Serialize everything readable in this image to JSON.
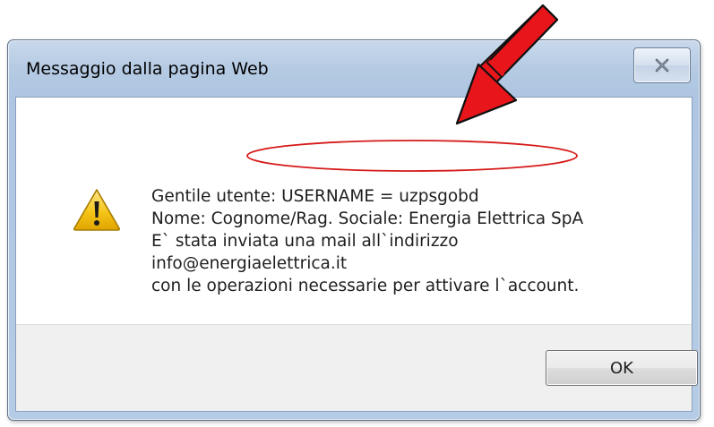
{
  "dialog": {
    "title": "Messaggio dalla pagina Web",
    "close_icon": "close-x-icon",
    "warning_icon": "warning-triangle-icon",
    "message_lines": [
      "Gentile utente: USERNAME = uzpsgobd",
      "Nome:  Cognome/Rag. Sociale: Energia Elettrica SpA",
      "E` stata inviata una mail all`indirizzo",
      "info@energiaelettrica.it",
      "con le operazioni necessarie per attivare l`account."
    ],
    "ok_label": "OK"
  },
  "annotations": {
    "arrow_color": "#e8161b",
    "ellipse_color": "#d61a1a"
  },
  "colors": {
    "frame_blue": "#b6cbe3",
    "footer_gray": "#f0f0f0",
    "warning_yellow": "#f5c518"
  }
}
